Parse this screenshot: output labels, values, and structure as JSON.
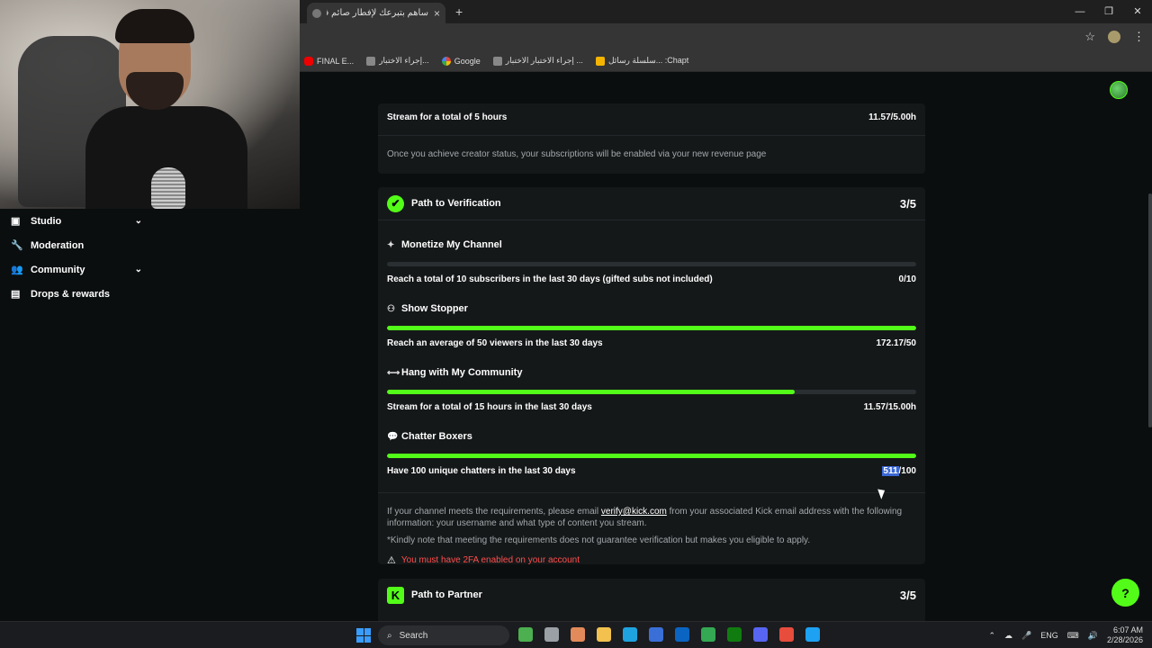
{
  "browser": {
    "tab_title": "ساهم بتبرعك لإفطار صائم في الـ",
    "tab_close": "×",
    "new_tab": "+",
    "window_controls": [
      "—",
      "❐",
      "✕"
    ],
    "bookmarks": [
      {
        "icon": "youtube-icon",
        "label": "FINAL E..."
      },
      {
        "icon": "bookmark-icon",
        "label": "إجراء الاختبار..."
      },
      {
        "icon": "google-icon",
        "label": "Google"
      },
      {
        "icon": "bookmark-icon",
        "label": "إجراء الاختبار الاختبار ..."
      },
      {
        "icon": "chart-icon",
        "label": "سلسلة رسائل... :Chapt"
      }
    ]
  },
  "sidebar": {
    "items": [
      {
        "icon": "▣",
        "label": "Studio",
        "chevron": "⌄"
      },
      {
        "icon": "🔧",
        "label": "Moderation"
      },
      {
        "icon": "👥",
        "label": "Community",
        "chevron": "⌄"
      },
      {
        "icon": "▤",
        "label": "Drops & rewards"
      }
    ]
  },
  "card1": {
    "req_label": "Stream for a total of 5 hours",
    "req_value": "11.57/5.00h",
    "note": "Once you achieve creator status, your subscriptions will be enabled via your new revenue page"
  },
  "verification": {
    "title": "Path to Verification",
    "score": "3/5",
    "badge": "✔",
    "requirements": [
      {
        "icon": "✦",
        "title": "Monetize My Channel",
        "label": "Reach a total of 10 subscribers in the last 30 days (gifted subs not included)",
        "value": "0/10",
        "progress": 0
      },
      {
        "icon": "⚇",
        "title": "Show Stopper",
        "label": "Reach an average of 50 viewers in the last 30 days",
        "value": "172.17/50",
        "progress": 1
      },
      {
        "icon": "⟷",
        "title": "Hang with My Community",
        "label": "Stream for a total of 15 hours in the last 30 days",
        "value": "11.57/15.00h",
        "progress": 0.771
      },
      {
        "icon": "💬",
        "title": "Chatter Boxers",
        "label": "Have 100 unique chatters in the last 30 days",
        "value_hl": "511",
        "value_rest": "/100",
        "progress": 1
      }
    ],
    "note_prefix": "If your channel meets the requirements, please email ",
    "note_email": "verify@kick.com",
    "note_suffix": " from your associated Kick email address with the following information: your username and what type of content you stream.",
    "disclaimer": "*Kindly note that meeting the requirements does not guarantee verification but makes you eligible to apply.",
    "warning_icon": "⚠",
    "warning": "You must have 2FA enabled on your account"
  },
  "partner": {
    "title": "Path to Partner",
    "score": "3/5",
    "badge": "K"
  },
  "support_icon": "?",
  "taskbar": {
    "search_label": "Search",
    "search_icon": "⌕",
    "app_colors": [
      "#4caf50",
      "#9aa0a6",
      "#e38a5a",
      "#f2c14e",
      "#1fa3e0",
      "#3a6fd8",
      "#0a64c2",
      "#34a853",
      "#107c10",
      "#5865f2",
      "#e74c3c",
      "#1da1f2"
    ],
    "lang": "ENG",
    "time": "6:07 AM",
    "date": "2/28/2026",
    "tray_icons": [
      "⌃",
      "☁",
      "🎤",
      "⌨",
      "🔊"
    ]
  }
}
